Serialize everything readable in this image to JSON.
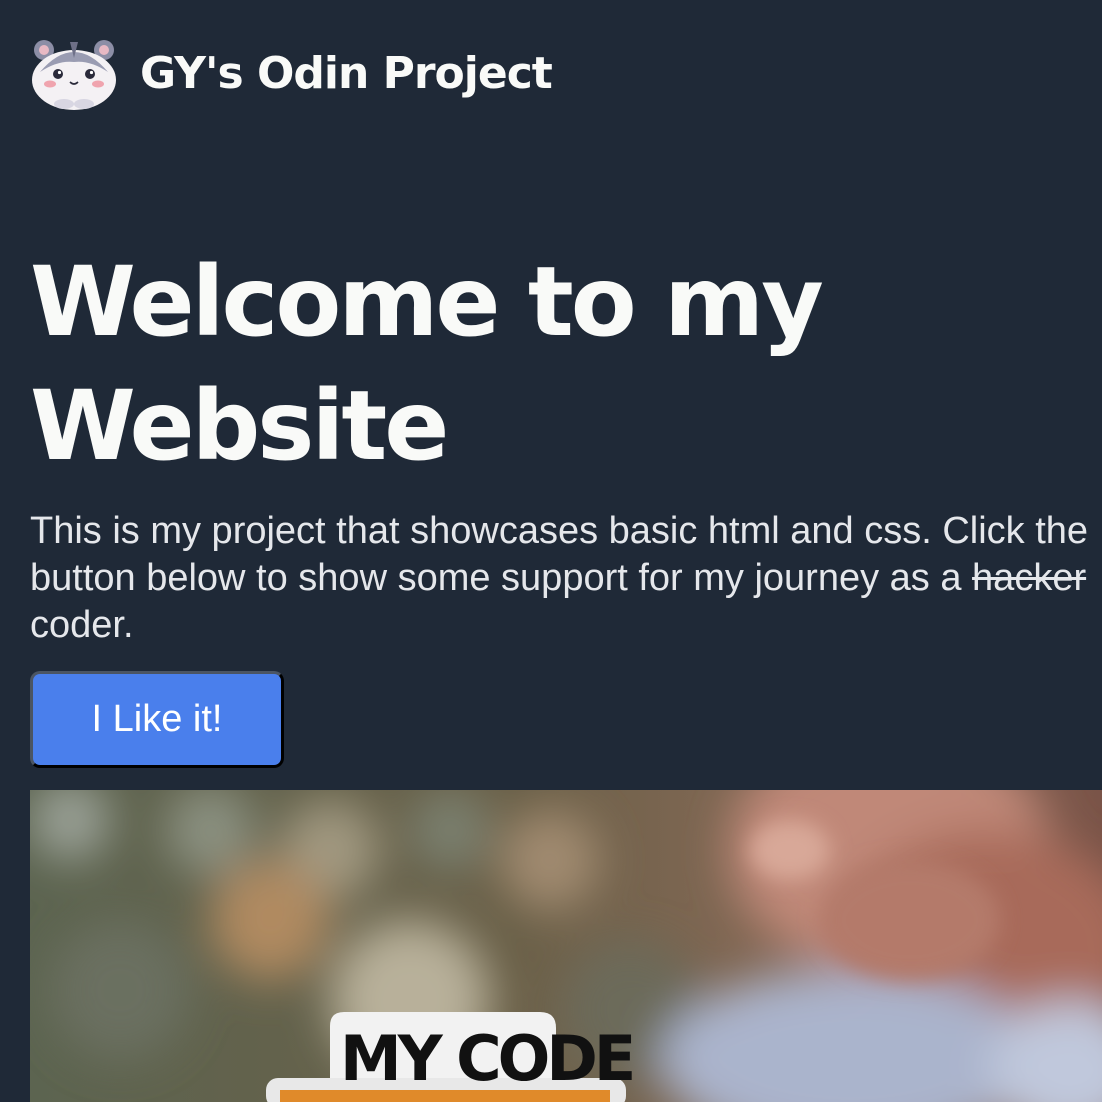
{
  "header": {
    "logo_icon": "hamster-icon",
    "title": "GY's Odin Project"
  },
  "hero": {
    "title": "Welcome to my Website",
    "text_before": "This is my project that showcases basic html and css. Click the button below to show some support for my journey as a ",
    "text_struck": "hacker",
    "text_after": " coder.",
    "button_label": "I Like it!"
  },
  "image": {
    "sticker_text": "MY CODE"
  },
  "colors": {
    "background": "#1f2937",
    "heading": "#f9faf8",
    "body_text": "#e5e7eb",
    "button": "#4a7fec"
  }
}
